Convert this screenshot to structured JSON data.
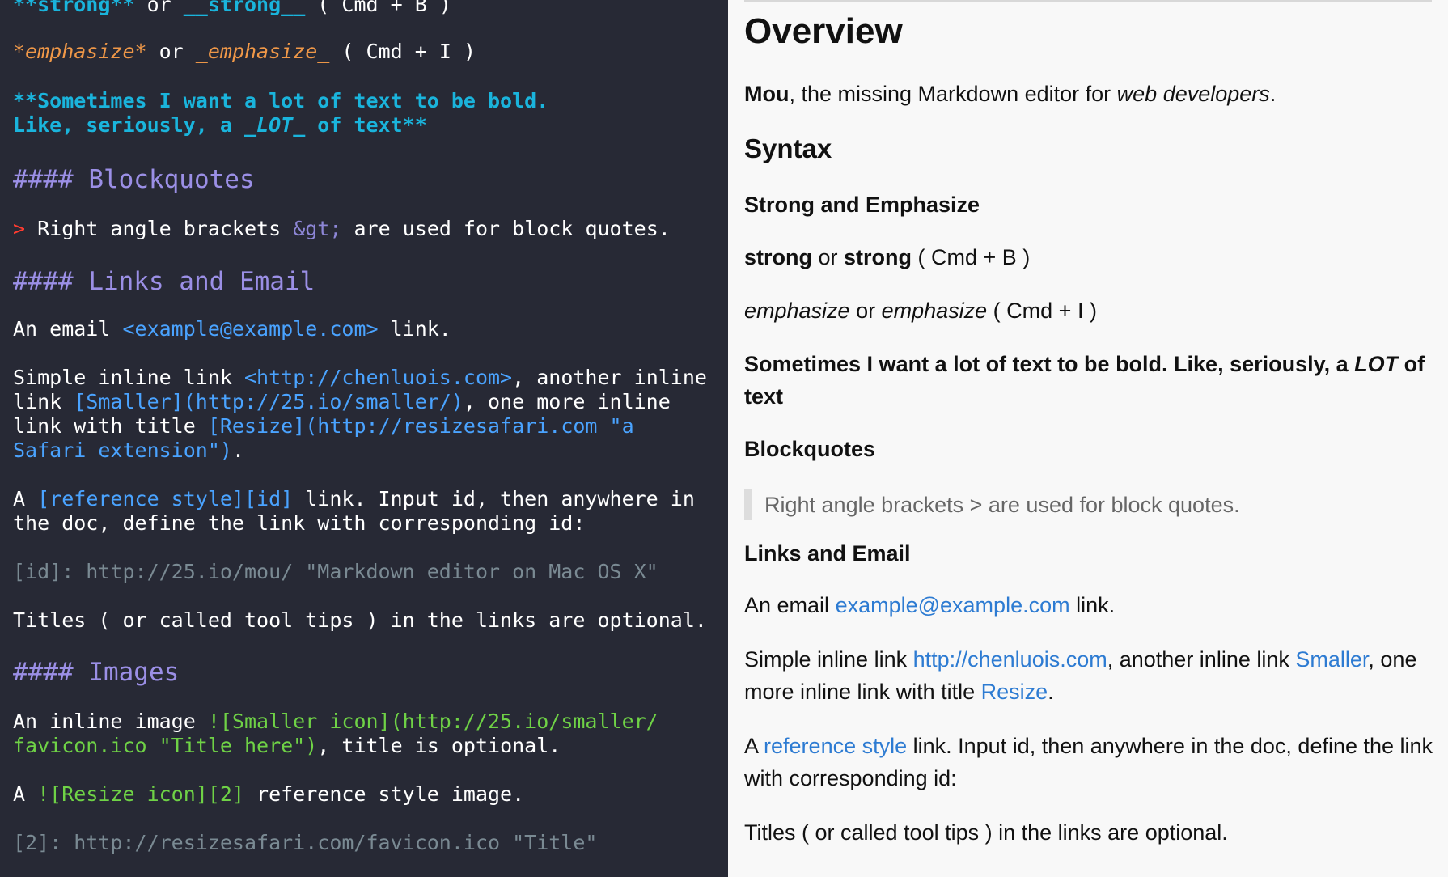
{
  "editor": {
    "lines": {
      "strong_line": {
        "part1": "**strong**",
        "part2": " or ",
        "part3": "__strong__",
        "part4": " ( Cmd + B )"
      },
      "em_line": {
        "part1": "*emphasize*",
        "part2": " or ",
        "part3": "_emphasize_",
        "part4": " ( Cmd + I )"
      },
      "bold_line1": "**Sometimes I want a lot of text to be bold.",
      "bold_line2a": "Like, seriously, a ",
      "bold_line2b": "_LOT_",
      "bold_line2c": " of text**",
      "h_blockquotes": "#### Blockquotes",
      "quote_line": {
        "marker": ">",
        "text1": " Right angle brackets ",
        "entity": "&gt;",
        "text2": " are used for block quotes."
      },
      "h_links": "#### Links and Email",
      "email_line": {
        "text1": "An email ",
        "link": "<example@example.com>",
        "text2": " link."
      },
      "inline1": {
        "text1": "Simple inline link ",
        "link": "<http://chenluois.com>",
        "text2": ", another inline"
      },
      "inline2": {
        "text1": "link ",
        "link": "[Smaller](http://25.io/smaller/)",
        "text2": ", one more inline"
      },
      "inline3": {
        "text1": "link with title ",
        "link": "[Resize](http://resizesafari.com \"a"
      },
      "inline4": {
        "link": "Safari extension\")",
        "text2": "."
      },
      "ref1": {
        "text1": "A ",
        "link": "[reference style][id]",
        "text2": " link. Input id, then anywhere in"
      },
      "ref2": "the doc, define the link with corresponding id:",
      "ref_def": "[id]: http://25.io/mou/ \"Markdown editor on Mac OS X\"",
      "titles": "Titles ( or called tool tips ) in the links are optional.",
      "h_images": "#### Images",
      "img1": {
        "text1": "An inline image ",
        "img": "![Smaller icon](http://25.io/smaller/"
      },
      "img2": {
        "img": "favicon.ico \"Title here\")",
        "text2": ", title is optional."
      },
      "img3": {
        "text1": "A ",
        "img": "![Resize icon][2]",
        "text2": " reference style image."
      },
      "img_def": "[2]: http://resizesafari.com/favicon.ico \"Title\""
    }
  },
  "preview": {
    "overview": "Overview",
    "intro": {
      "bold": "Mou",
      "text1": ", the missing Markdown editor for ",
      "em": "web developers",
      "text2": "."
    },
    "syntax": "Syntax",
    "strong_heading": "Strong and Emphasize",
    "strong_line": {
      "b1": "strong",
      "t1": " or ",
      "b2": "strong",
      "t2": " ( Cmd + B )"
    },
    "em_line": {
      "e1": "emphasize",
      "t1": " or ",
      "e2": "emphasize",
      "t2": " ( Cmd + I )"
    },
    "bold_para": {
      "line1": "Sometimes I want a lot of text to be bold. Like, seriously, a ",
      "lot": "LOT",
      "line1b": " of",
      "line2": "text"
    },
    "blockquotes": "Blockquotes",
    "quote": "Right angle brackets > are used for block quotes.",
    "links_heading": "Links and Email",
    "email": {
      "t1": "An email ",
      "link": "example@example.com",
      "t2": " link."
    },
    "inline": {
      "t1": "Simple inline link ",
      "link1": "http://chenluois.com",
      "t2": ", another inline link ",
      "link2": "Smaller",
      "t3": ", one",
      "t4": "more inline link with title ",
      "link3": "Resize",
      "t5": "."
    },
    "reference": {
      "t1": "A ",
      "link": "reference style",
      "t2": " link. Input id, then anywhere in the doc, define the link",
      "t3": "with corresponding id:"
    },
    "titles": "Titles ( or called tool tips ) in the links are optional."
  }
}
